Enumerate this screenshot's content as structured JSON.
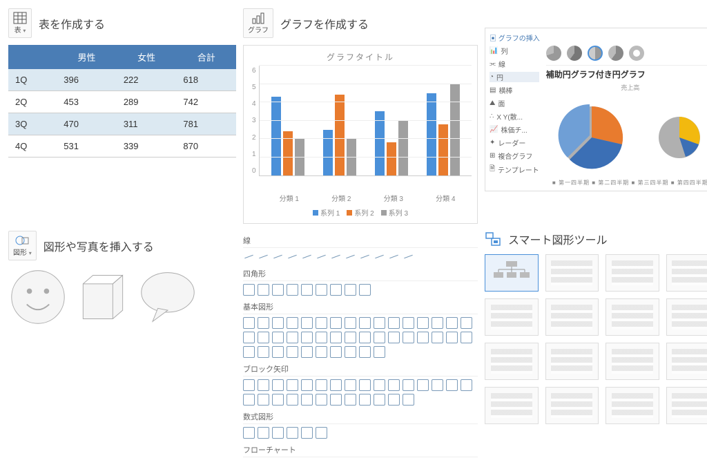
{
  "sections": {
    "table": {
      "btn_label": "表",
      "title": "表を作成する"
    },
    "chart": {
      "btn_label": "グラフ",
      "title": "グラフを作成する"
    },
    "shape": {
      "btn_label": "図形",
      "title": "図形や写真を挿入する"
    },
    "smart": {
      "title": "スマート図形ツール"
    }
  },
  "table_data": {
    "headers": [
      "",
      "男性",
      "女性",
      "合計"
    ],
    "rows": [
      [
        "1Q",
        "396",
        "222",
        "618"
      ],
      [
        "2Q",
        "453",
        "289",
        "742"
      ],
      [
        "3Q",
        "470",
        "311",
        "781"
      ],
      [
        "4Q",
        "531",
        "339",
        "870"
      ]
    ]
  },
  "chart_data": [
    {
      "type": "bar",
      "title": "グラフタイトル",
      "ylim": [
        0,
        6
      ],
      "yticks": [
        0,
        1,
        2,
        3,
        4,
        5,
        6
      ],
      "categories": [
        "分類 1",
        "分類 2",
        "分類 3",
        "分類 4"
      ],
      "series": [
        {
          "name": "系列 1",
          "color": "#4a90d9",
          "values": [
            4.3,
            2.5,
            3.5,
            4.5
          ]
        },
        {
          "name": "系列 2",
          "color": "#e87b2e",
          "values": [
            2.4,
            4.4,
            1.8,
            2.8
          ]
        },
        {
          "name": "系列 3",
          "color": "#a0a0a0",
          "values": [
            2.0,
            2.0,
            3.0,
            5.0
          ]
        }
      ]
    },
    {
      "type": "pie",
      "panel_title": "グラフの挿入",
      "pie_title": "補助円グラフ付き円グラフ",
      "subtitle": "売上高",
      "type_list": [
        "列",
        "線",
        "円",
        "横棒",
        "面",
        "X Y(散...",
        "株価チ...",
        "レーダー",
        "複合グラフ",
        "テンプレート"
      ],
      "main_slices": [
        {
          "name": "第一四半期",
          "value": 45,
          "color": "#3b6fb5"
        },
        {
          "name": "第二四半期",
          "value": 20,
          "color": "#e87b2e"
        },
        {
          "name": "第三四半期",
          "value": 35,
          "color": "#b0b0b0"
        }
      ],
      "sub_slices": [
        {
          "name": "第三四半期",
          "value": 60,
          "color": "#b0b0b0"
        },
        {
          "name": "第四四半期",
          "value": 25,
          "color": "#f2b90f"
        },
        {
          "name": "第一四半期",
          "value": 15,
          "color": "#3b6fb5"
        }
      ],
      "legend_text": "■ 第一四半期  ■ 第二四半期  ■ 第三四半期  ■ 第四四半期"
    }
  ],
  "shapes_gallery": {
    "cat_lines": "線",
    "cat_rects": "四角形",
    "cat_basic": "基本図形",
    "cat_arrows": "ブロック矢印",
    "cat_equation": "数式図形",
    "cat_flow": "フローチャート"
  }
}
